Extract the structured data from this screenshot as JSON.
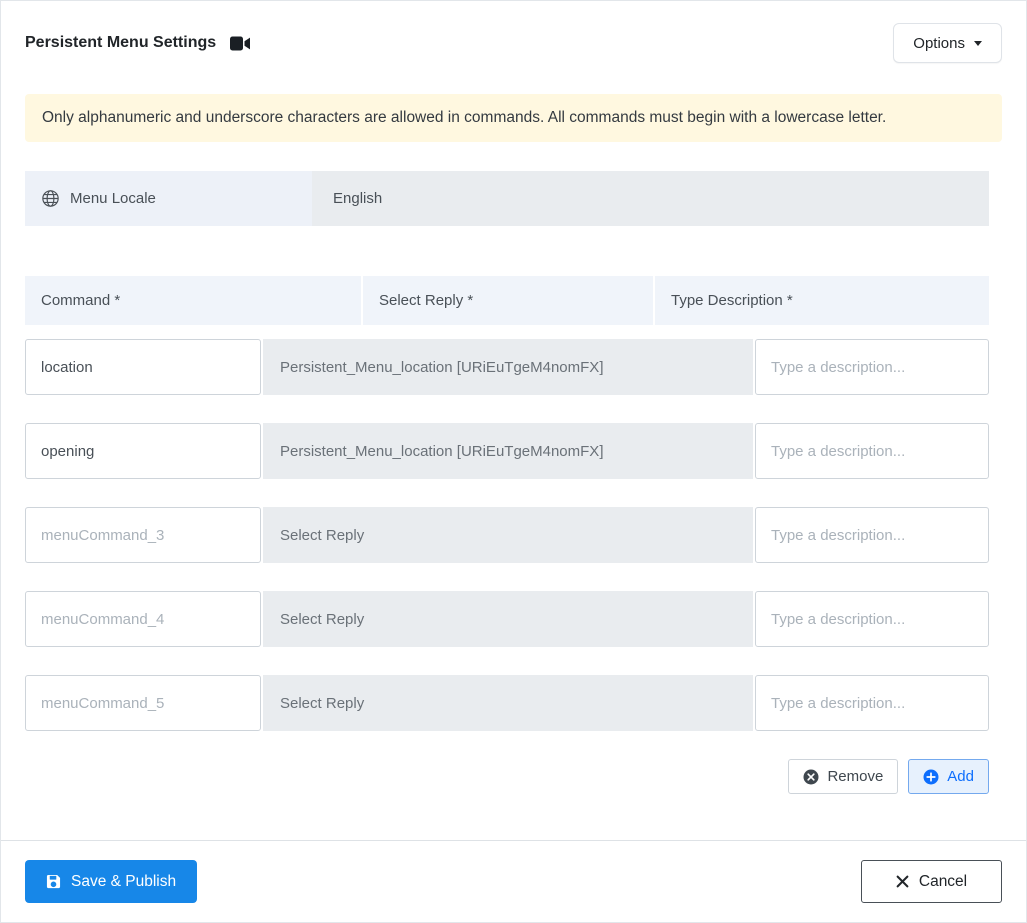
{
  "header": {
    "title": "Persistent Menu Settings",
    "options_label": "Options"
  },
  "alert": {
    "text": "Only alphanumeric and underscore characters are allowed in commands. All commands must begin with a lowercase letter."
  },
  "locale": {
    "label": "Menu Locale",
    "value": "English"
  },
  "table": {
    "headers": {
      "command": "Command *",
      "reply": "Select Reply *",
      "description": "Type Description *"
    },
    "rows": [
      {
        "command_value": "location",
        "command_placeholder": "",
        "reply": "Persistent_Menu_location [URiEuTgeM4nomFX]",
        "description_value": "",
        "description_placeholder": "Type a description..."
      },
      {
        "command_value": "opening",
        "command_placeholder": "",
        "reply": "Persistent_Menu_location [URiEuTgeM4nomFX]",
        "description_value": "",
        "description_placeholder": "Type a description..."
      },
      {
        "command_value": "",
        "command_placeholder": "menuCommand_3",
        "reply": "Select Reply",
        "description_value": "",
        "description_placeholder": "Type a description..."
      },
      {
        "command_value": "",
        "command_placeholder": "menuCommand_4",
        "reply": "Select Reply",
        "description_value": "",
        "description_placeholder": "Type a description..."
      },
      {
        "command_value": "",
        "command_placeholder": "menuCommand_5",
        "reply": "Select Reply",
        "description_value": "",
        "description_placeholder": "Type a description..."
      }
    ]
  },
  "row_actions": {
    "remove_label": "Remove",
    "add_label": "Add"
  },
  "footer": {
    "save_label": "Save & Publish",
    "cancel_label": "Cancel"
  },
  "colors": {
    "primary_blue": "#1787e8",
    "link_blue": "#0d6efd",
    "alert_bg": "#fff8e0",
    "header_cell_bg": "#f0f4fa",
    "select_bg": "#e9ecef",
    "locale_label_bg": "#edf1f8"
  }
}
